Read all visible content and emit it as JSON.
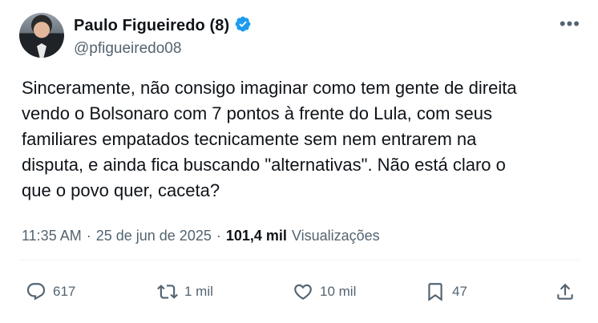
{
  "author": {
    "name": "Paulo Figueiredo (8)",
    "handle": "@pfigueiredo08",
    "verified": true
  },
  "tweet": {
    "text": "Sinceramente, não consigo imaginar como tem gente de direita\nvendo o Bolsonaro com 7 pontos à frente do Lula, com seus\nfamiliares empatados tecnicamente sem nem entrarem na\ndisputa, e ainda fica buscando \"alternativas\". Não está claro o\nque o povo quer, caceta?",
    "time": "11:35 AM",
    "separator": "·",
    "date": "25 de jun de 2025",
    "views_count": "101,4 mil",
    "views_label": "Visualizações"
  },
  "actions": {
    "replies": "617",
    "reposts": "1 mil",
    "likes": "10 mil",
    "bookmarks": "47"
  },
  "icons": [
    "verified-badge-icon",
    "more-icon",
    "reply-icon",
    "repost-icon",
    "like-icon",
    "bookmark-icon",
    "share-icon"
  ],
  "colors": {
    "accent": "#1d9bf0",
    "secondary_text": "#536471",
    "primary_text": "#0f1419"
  }
}
